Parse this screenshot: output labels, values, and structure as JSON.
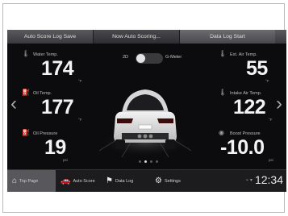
{
  "topbar": {
    "auto_score_log_save": "Auto Score Log Save",
    "now_auto_scoring": "Now Auto Scoring...",
    "data_log_start": "Data Log Start"
  },
  "gauges": {
    "water_temp": {
      "label": "Water Temp.",
      "value": "174",
      "unit": "°F"
    },
    "oil_temp": {
      "label": "Oil Temp.",
      "value": "177",
      "unit": "°F"
    },
    "oil_pressure": {
      "label": "Oil Pressure",
      "value": "19",
      "unit": "psi"
    },
    "ext_air_temp": {
      "label": "Ext. Air Temp.",
      "value": "55",
      "unit": "°F"
    },
    "intake_air_temp": {
      "label": "Intake Air Temp.",
      "value": "122",
      "unit": "°F"
    },
    "boost_pressure": {
      "label": "Boost Pressure",
      "value": "-10.0",
      "unit": "psi"
    }
  },
  "view_toggle": {
    "left_label": "2D",
    "right_label": "G-Meter",
    "state": "2D"
  },
  "pager": {
    "pages": 4,
    "current": 2
  },
  "nav": {
    "top_page": "Top Page",
    "auto_score": "Auto Score",
    "data_log": "Data Log",
    "settings": "Settings"
  },
  "status": {
    "time": "12:34"
  },
  "arrows": {
    "left": "‹",
    "right": "›"
  },
  "icons": {
    "water_temp": "thermometer-icon",
    "oil_temp": "oil-can-icon",
    "oil_pressure": "oil-pressure-icon",
    "ext_air_temp": "thermometer-icon",
    "intake_air_temp": "intake-thermometer-icon",
    "boost_pressure": "turbo-icon",
    "home": "home-icon",
    "auto_score": "car-icon",
    "data_log": "flag-icon",
    "settings": "gear-icon"
  }
}
